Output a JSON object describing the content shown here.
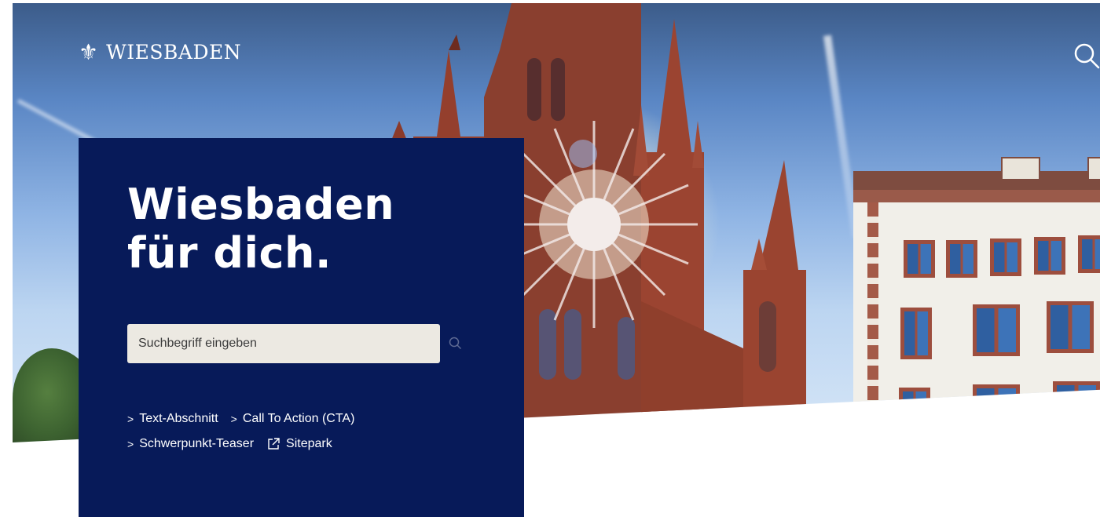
{
  "header": {
    "brand_name": "WIESBADEN",
    "brand_icon": "fleur-de-lis-icon",
    "search_icon": "search-icon"
  },
  "hero": {
    "headline_line1": "Wiesbaden",
    "headline_line2": "für dich.",
    "search": {
      "placeholder": "Suchbegriff eingeben",
      "value": ""
    },
    "links": [
      {
        "label": "Text-Abschnitt",
        "icon": "chevron-right-icon"
      },
      {
        "label": "Call To Action (CTA)",
        "icon": "chevron-right-icon"
      },
      {
        "label": "Schwerpunkt-Teaser",
        "icon": "chevron-right-icon"
      },
      {
        "label": "Sitepark",
        "icon": "external-link-icon"
      }
    ]
  },
  "colors": {
    "panel_background": "#071a59",
    "search_background": "#ece9e2",
    "text_on_dark": "#ffffff"
  }
}
